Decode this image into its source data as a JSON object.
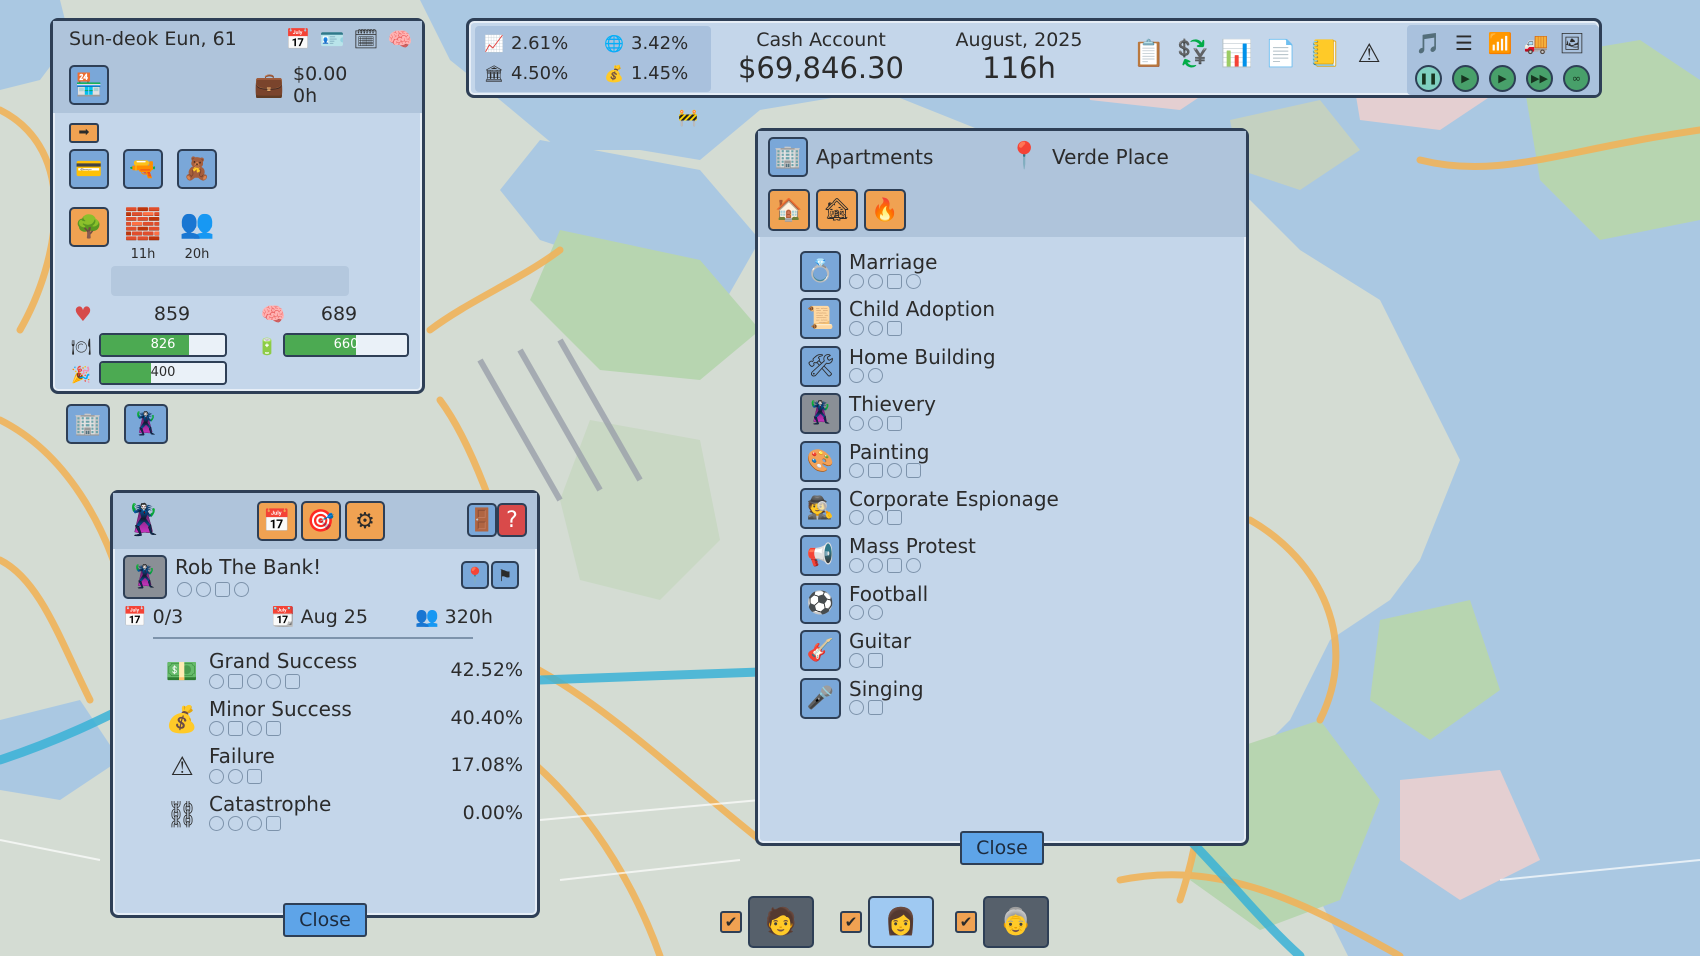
{
  "character": {
    "name": "Sun-deok Eun, 61",
    "money": "$0.00",
    "hours": "0h",
    "skill_labels": [
      "11h",
      "20h"
    ],
    "health": "859",
    "mind": "689",
    "bars": [
      {
        "value": "826",
        "fill": 0.71
      },
      {
        "value": "660",
        "fill": 0.58
      },
      {
        "value": "400",
        "fill": 0.4
      }
    ]
  },
  "top_bar": {
    "stats": [
      "2.61%",
      "3.42%",
      "4.50%",
      "1.45%"
    ],
    "cash_label": "Cash Account",
    "cash_value": "$69,846.30",
    "date_label": "August, 2025",
    "hours_value": "116h"
  },
  "activities": {
    "category": "Apartments",
    "location": "Verde Place",
    "items": [
      "Marriage",
      "Child Adoption",
      "Home Building",
      "Thievery",
      "Painting",
      "Corporate Espionage",
      "Mass Protest",
      "Football",
      "Guitar",
      "Singing"
    ],
    "close_label": "Close"
  },
  "crime": {
    "title": "Rob The Bank!",
    "attempts": "0/3",
    "date": "Aug 25",
    "duration": "320h",
    "outcomes": [
      {
        "label": "Grand Success",
        "pct": "42.52%"
      },
      {
        "label": "Minor Success",
        "pct": "40.40%"
      },
      {
        "label": "Failure",
        "pct": "17.08%"
      },
      {
        "label": "Catastrophe",
        "pct": "0.00%"
      }
    ],
    "close_label": "Close"
  },
  "colors": {
    "panel_bg": "#c4d6ea",
    "panel_border": "#2e3f56",
    "accent_orange": "#f0a252",
    "button_blue": "#5ea4e8",
    "bar_green": "#4caa52"
  }
}
